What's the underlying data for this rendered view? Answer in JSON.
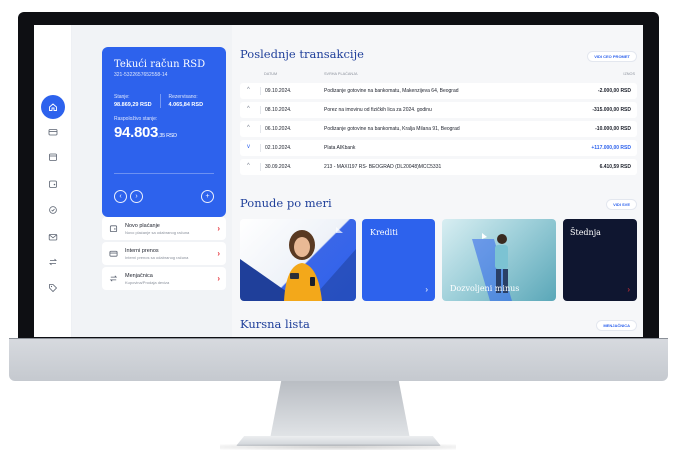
{
  "left_panel": {
    "account": {
      "title": "Tekući račun RSD",
      "number": "321-5322657652558-14",
      "balance_label": "Stanje:",
      "balance_value": "98.869,29 RSD",
      "reserved_label": "Rezervisano:",
      "reserved_value": "4.065,84 RSD",
      "available_label": "Raspoloživo stanje:",
      "available_value": "94.803",
      "available_suffix": ",35 RSD",
      "btn_prev": "‹",
      "btn_next": "›",
      "btn_add": "+"
    },
    "quick_actions": [
      {
        "title": "Novo plaćanje",
        "subtitle": "Novo plaćanje sa odabranog računa",
        "icon": "payment-icon",
        "arrow": "›"
      },
      {
        "title": "Interni prenos",
        "subtitle": "Interni prenos sa odabranog računa",
        "icon": "transfer-icon",
        "arrow": "›"
      },
      {
        "title": "Menjačnica",
        "subtitle": "Kupovina/Prodaja deviza",
        "icon": "exchange-icon",
        "arrow": "›"
      }
    ]
  },
  "transactions": {
    "title": "Poslednje transakcije",
    "view_all": "VIDI CEO PROMET",
    "columns": {
      "date": "DATUM",
      "desc": "SVRHA PLAĆANJA",
      "amount": "IZNOS"
    },
    "rows": [
      {
        "date": "09.10.2024.",
        "desc": "Podizanje gotovine na bankomatu, Makenzijeva 64, Beograd",
        "amount": "-2.000,00 RSD",
        "direction": "out"
      },
      {
        "date": "08.10.2024.",
        "desc": "Porez na imovinu od fizičkih lica za 2024. godinu",
        "amount": "-315.000,00 RSD",
        "direction": "out"
      },
      {
        "date": "06.10.2024.",
        "desc": "Podizanje gotovine na bankomatu, Kralja Milana 91, Beograd",
        "amount": "-10.000,00 RSD",
        "direction": "out"
      },
      {
        "date": "02.10.2024.",
        "desc": "Plata AIKbank",
        "amount": "+117.000,00 RSD",
        "direction": "in"
      },
      {
        "date": "30.09.2024.",
        "desc": "213 - MAXI197 RS- BEOGRAD (DL20048)MCC5331",
        "amount": "6.410,59 RSD",
        "direction": "out"
      }
    ]
  },
  "offers": {
    "title": "Ponude po meri",
    "view_all": "VIDI SVE",
    "cards": [
      {
        "label": "Krediti",
        "arrow": "›"
      },
      {
        "label": "Dozvoljeni minus",
        "arrow": ""
      },
      {
        "label": "Štednja",
        "arrow": "›"
      }
    ]
  },
  "exchange": {
    "title": "Kursna lista",
    "button": "MENJAČNICA"
  },
  "colors": {
    "brand_blue": "#2d62ed",
    "heading_blue": "#1f3f9a",
    "accent_red": "#e5333a",
    "dark_card": "#0f1630"
  }
}
